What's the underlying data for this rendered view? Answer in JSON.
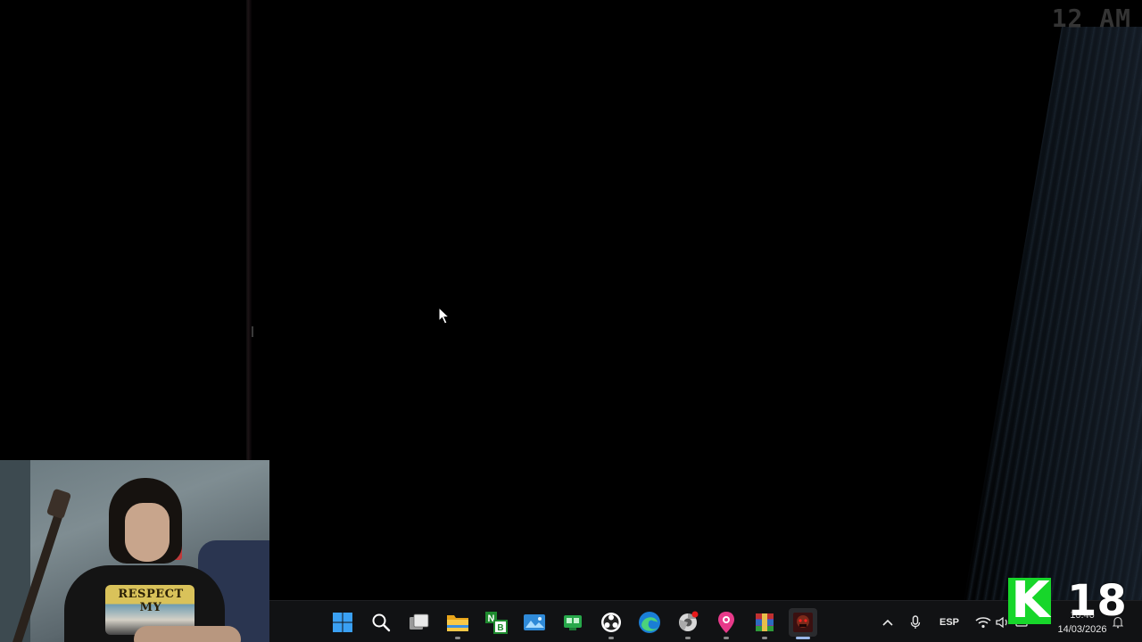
{
  "game": {
    "hour_display": "12 AM"
  },
  "webcam": {
    "shirt_text": "RESPECT MY"
  },
  "taskbar": {
    "pinned": [
      {
        "name": "start-button",
        "icon": "windows-logo-icon",
        "running": false,
        "active": false
      },
      {
        "name": "search-button",
        "icon": "search-icon",
        "running": false,
        "active": false
      },
      {
        "name": "task-view-button",
        "icon": "task-view-icon",
        "running": false,
        "active": false
      },
      {
        "name": "file-explorer-button",
        "icon": "folder-icon",
        "running": true,
        "active": false
      },
      {
        "name": "notepad-plus-button",
        "icon": "notepad-plus-icon",
        "running": false,
        "active": false
      },
      {
        "name": "photos-button",
        "icon": "photos-icon",
        "running": false,
        "active": false
      },
      {
        "name": "green-app-button",
        "icon": "green-app-icon",
        "running": false,
        "active": false
      },
      {
        "name": "obs-button",
        "icon": "obs-icon",
        "running": true,
        "active": false
      },
      {
        "name": "edge-button",
        "icon": "edge-icon",
        "running": false,
        "active": false
      },
      {
        "name": "steam-like-button",
        "icon": "chrome-like-icon",
        "running": true,
        "active": false
      },
      {
        "name": "map-pin-app-button",
        "icon": "pin-icon",
        "running": true,
        "active": false
      },
      {
        "name": "winrar-button",
        "icon": "winrar-icon",
        "running": true,
        "active": false
      },
      {
        "name": "fnaf-game-button",
        "icon": "game-icon",
        "running": true,
        "active": true
      }
    ],
    "tray": {
      "chevron": "^",
      "language": "ESP",
      "time": "10:46",
      "date": "14/03/2026"
    }
  },
  "overlay": {
    "k_logo": "K",
    "rating": "18"
  },
  "colors": {
    "taskbar_bg": "#111214",
    "k_green": "#17d62a",
    "accent": "#9bb7e8"
  }
}
